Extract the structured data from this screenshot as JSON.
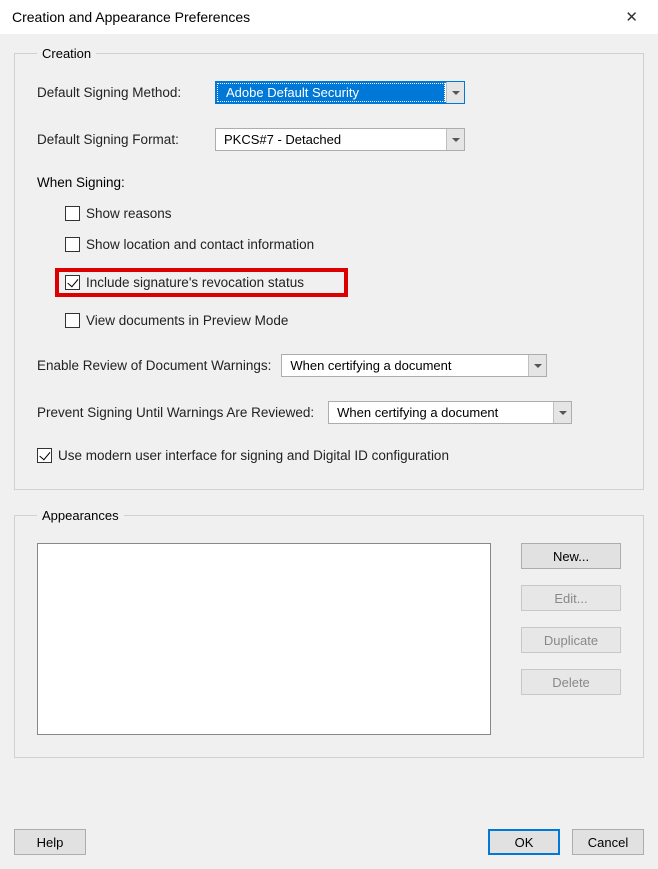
{
  "title": "Creation and Appearance Preferences",
  "creation": {
    "legend": "Creation",
    "signingMethod": {
      "label": "Default Signing Method:",
      "value": "Adobe Default Security"
    },
    "signingFormat": {
      "label": "Default Signing Format:",
      "value": "PKCS#7 - Detached"
    },
    "whenSigningLabel": "When Signing:",
    "cbShowReasons": "Show reasons",
    "cbShowLocation": "Show location and contact information",
    "cbIncludeRevocation": "Include signature's revocation status",
    "cbViewPreview": "View documents in Preview Mode",
    "reviewWarnings": {
      "label": "Enable Review of Document Warnings:",
      "value": "When certifying a document"
    },
    "preventSigning": {
      "label": "Prevent Signing Until Warnings Are Reviewed:",
      "value": "When certifying a document"
    },
    "cbModernUI": "Use modern user interface for signing and Digital ID configuration"
  },
  "appearances": {
    "legend": "Appearances",
    "btnNew": "New...",
    "btnEdit": "Edit...",
    "btnDuplicate": "Duplicate",
    "btnDelete": "Delete"
  },
  "buttons": {
    "help": "Help",
    "ok": "OK",
    "cancel": "Cancel"
  }
}
